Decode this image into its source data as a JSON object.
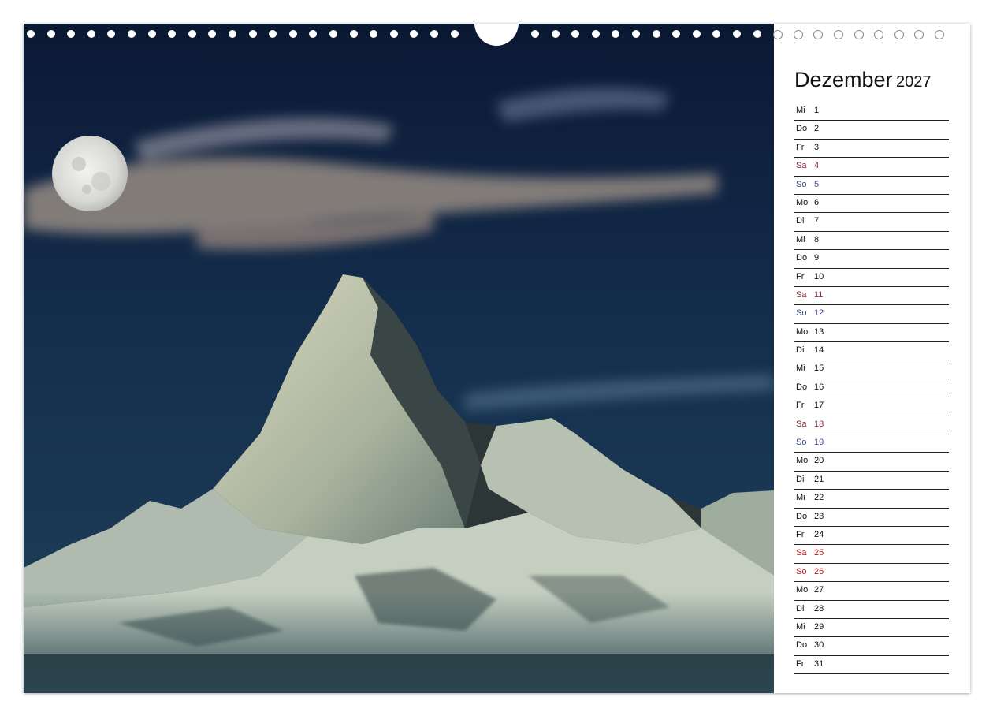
{
  "calendar": {
    "month": "Dezember",
    "year": "2027",
    "colors": {
      "saturday": "#8a2a3a",
      "sunday": "#3a4a8a",
      "holiday": "#c0202a"
    },
    "days": [
      {
        "wd": "Mi",
        "d": "1",
        "type": "weekday"
      },
      {
        "wd": "Do",
        "d": "2",
        "type": "weekday"
      },
      {
        "wd": "Fr",
        "d": "3",
        "type": "weekday"
      },
      {
        "wd": "Sa",
        "d": "4",
        "type": "sat"
      },
      {
        "wd": "So",
        "d": "5",
        "type": "sun"
      },
      {
        "wd": "Mo",
        "d": "6",
        "type": "weekday"
      },
      {
        "wd": "Di",
        "d": "7",
        "type": "weekday"
      },
      {
        "wd": "Mi",
        "d": "8",
        "type": "weekday"
      },
      {
        "wd": "Do",
        "d": "9",
        "type": "weekday"
      },
      {
        "wd": "Fr",
        "d": "10",
        "type": "weekday"
      },
      {
        "wd": "Sa",
        "d": "11",
        "type": "sat"
      },
      {
        "wd": "So",
        "d": "12",
        "type": "sun"
      },
      {
        "wd": "Mo",
        "d": "13",
        "type": "weekday"
      },
      {
        "wd": "Di",
        "d": "14",
        "type": "weekday"
      },
      {
        "wd": "Mi",
        "d": "15",
        "type": "weekday"
      },
      {
        "wd": "Do",
        "d": "16",
        "type": "weekday"
      },
      {
        "wd": "Fr",
        "d": "17",
        "type": "weekday"
      },
      {
        "wd": "Sa",
        "d": "18",
        "type": "sat"
      },
      {
        "wd": "So",
        "d": "19",
        "type": "sun"
      },
      {
        "wd": "Mo",
        "d": "20",
        "type": "weekday"
      },
      {
        "wd": "Di",
        "d": "21",
        "type": "weekday"
      },
      {
        "wd": "Mi",
        "d": "22",
        "type": "weekday"
      },
      {
        "wd": "Do",
        "d": "23",
        "type": "weekday"
      },
      {
        "wd": "Fr",
        "d": "24",
        "type": "weekday"
      },
      {
        "wd": "Sa",
        "d": "25",
        "type": "holiday"
      },
      {
        "wd": "So",
        "d": "26",
        "type": "holiday"
      },
      {
        "wd": "Mo",
        "d": "27",
        "type": "weekday"
      },
      {
        "wd": "Di",
        "d": "28",
        "type": "weekday"
      },
      {
        "wd": "Mi",
        "d": "29",
        "type": "weekday"
      },
      {
        "wd": "Do",
        "d": "30",
        "type": "weekday"
      },
      {
        "wd": "Fr",
        "d": "31",
        "type": "weekday"
      }
    ]
  },
  "photo": {
    "subject": "mountain-peak-under-full-moon",
    "colors": {
      "sky_top": "#0c1a3a",
      "sky_bottom": "#1d3a55",
      "snow": "#c9d3c4",
      "rock": "#2a3133",
      "moon": "#e6e6e6"
    }
  }
}
